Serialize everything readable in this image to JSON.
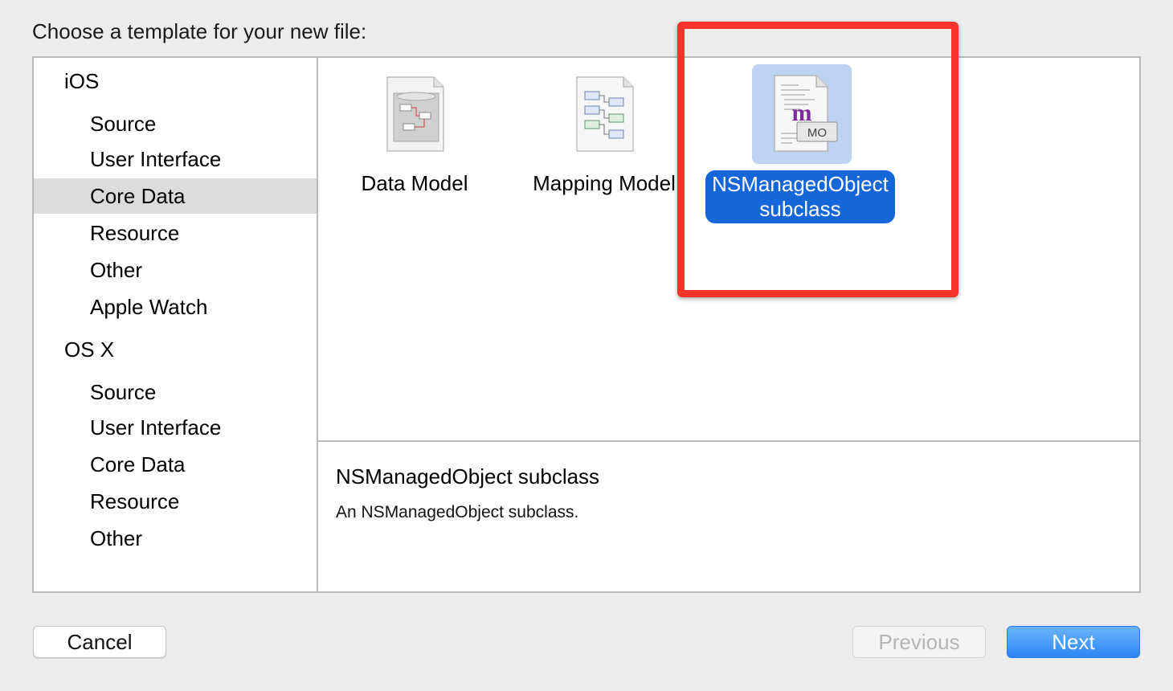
{
  "dialog": {
    "heading": "Choose a template for your new file:"
  },
  "sidebar": {
    "sections": [
      {
        "title": "iOS",
        "items": [
          "Source",
          "User Interface",
          "Core Data",
          "Resource",
          "Other",
          "Apple Watch"
        ]
      },
      {
        "title": "OS X",
        "items": [
          "Source",
          "User Interface",
          "Core Data",
          "Resource",
          "Other"
        ]
      }
    ],
    "selected": "iOS / Core Data"
  },
  "templates": [
    {
      "label": "Data Model",
      "icon": "data-model-icon",
      "selected": false
    },
    {
      "label": "Mapping Model",
      "icon": "mapping-model-icon",
      "selected": false
    },
    {
      "label": "NSManagedObject subclass",
      "icon": "nsmanagedobject-icon",
      "icon_text": "m",
      "badge": "MO",
      "selected": true
    }
  ],
  "description": {
    "title": "NSManagedObject subclass",
    "text": "An NSManagedObject subclass."
  },
  "buttons": {
    "cancel": "Cancel",
    "previous": "Previous",
    "next": "Next",
    "previous_enabled": false
  },
  "colors": {
    "selection_blue": "#1567d9",
    "highlight_red": "#f5332a",
    "icon_selected_bg": "#bcd3f1",
    "sidebar_selected_bg": "#dcdcdc"
  }
}
